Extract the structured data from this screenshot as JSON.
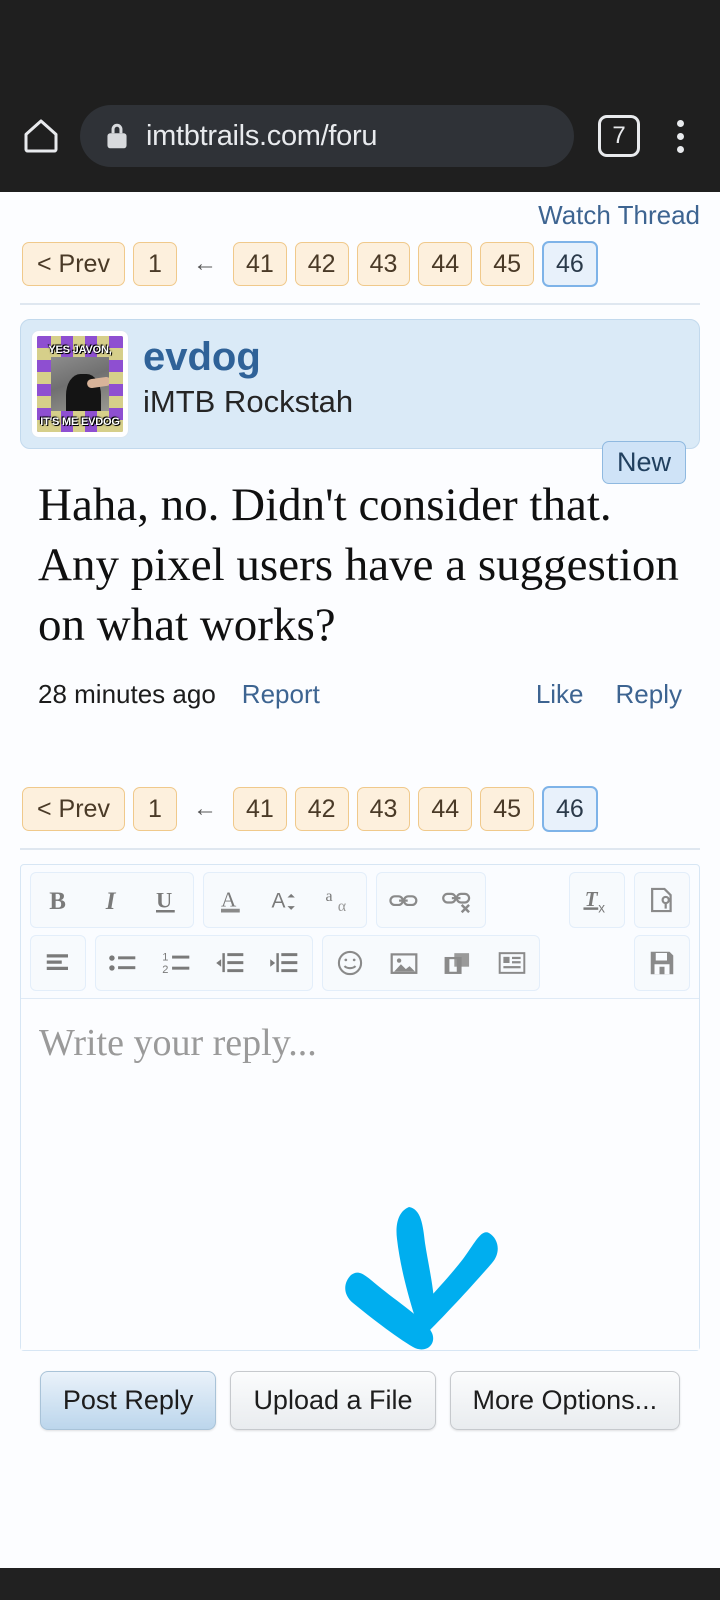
{
  "browser": {
    "url": "imtbtrails.com/foru",
    "tab_count": "7",
    "home_icon": "home-icon",
    "lock_icon": "lock-icon",
    "menu_icon": "more-vertical-icon"
  },
  "thread": {
    "watch_link": "Watch Thread"
  },
  "pagination": {
    "prev_label": "< Prev",
    "first_page": "1",
    "gap_arrow": "←",
    "pages": [
      "41",
      "42",
      "43",
      "44",
      "45",
      "46"
    ],
    "current_page": "46"
  },
  "post": {
    "username": "evdog",
    "user_title": "iMTB Rockstah",
    "new_badge": "New",
    "avatar": {
      "alt": "evdog-avatar-meme",
      "top_text": "YES JAVON,",
      "bottom_text": "IT'S ME EVDOG"
    },
    "body": "Haha, no. Didn't consider that. Any pixel users have a suggestion on what works?",
    "timestamp": "28 minutes ago",
    "report_label": "Report",
    "like_label": "Like",
    "reply_label": "Reply"
  },
  "editor": {
    "placeholder": "Write your reply...",
    "toolbar_row1": [
      {
        "group": 1,
        "icons": [
          "bold-icon",
          "italic-icon",
          "underline-icon"
        ]
      },
      {
        "group": 2,
        "icons": [
          "text-color-icon",
          "font-size-icon",
          "font-family-icon"
        ]
      },
      {
        "group": 3,
        "icons": [
          "link-icon",
          "unlink-icon"
        ]
      },
      {
        "group": 4,
        "icons": [
          "remove-formatting-icon"
        ]
      },
      {
        "group": 5,
        "icons": [
          "source-tools-icon"
        ]
      }
    ],
    "toolbar_row2": [
      {
        "group": 1,
        "icons": [
          "align-left-icon"
        ]
      },
      {
        "group": 2,
        "icons": [
          "bullet-list-icon",
          "numbered-list-icon",
          "outdent-icon",
          "indent-icon"
        ]
      },
      {
        "group": 3,
        "icons": [
          "emoji-icon",
          "insert-image-icon",
          "insert-media-icon",
          "insert-quote-icon"
        ]
      },
      {
        "group": 4,
        "icons": [
          "save-draft-icon"
        ]
      }
    ]
  },
  "annotation": {
    "name": "down-arrow-annotation",
    "color": "#00AEEF"
  },
  "actions": {
    "post_reply": "Post Reply",
    "upload_file": "Upload a File",
    "more_options": "More Options..."
  },
  "colors": {
    "chrome_bg": "#1f1f1f",
    "link_blue": "#3d6491",
    "username_blue": "#2f6298",
    "page_tan_bg": "#fdf0dd",
    "page_tan_border": "#f0c98b",
    "current_page_bg": "#e8f1fb",
    "post_head_bg": "#daeaf7",
    "annotation_cyan": "#00AEEF"
  }
}
